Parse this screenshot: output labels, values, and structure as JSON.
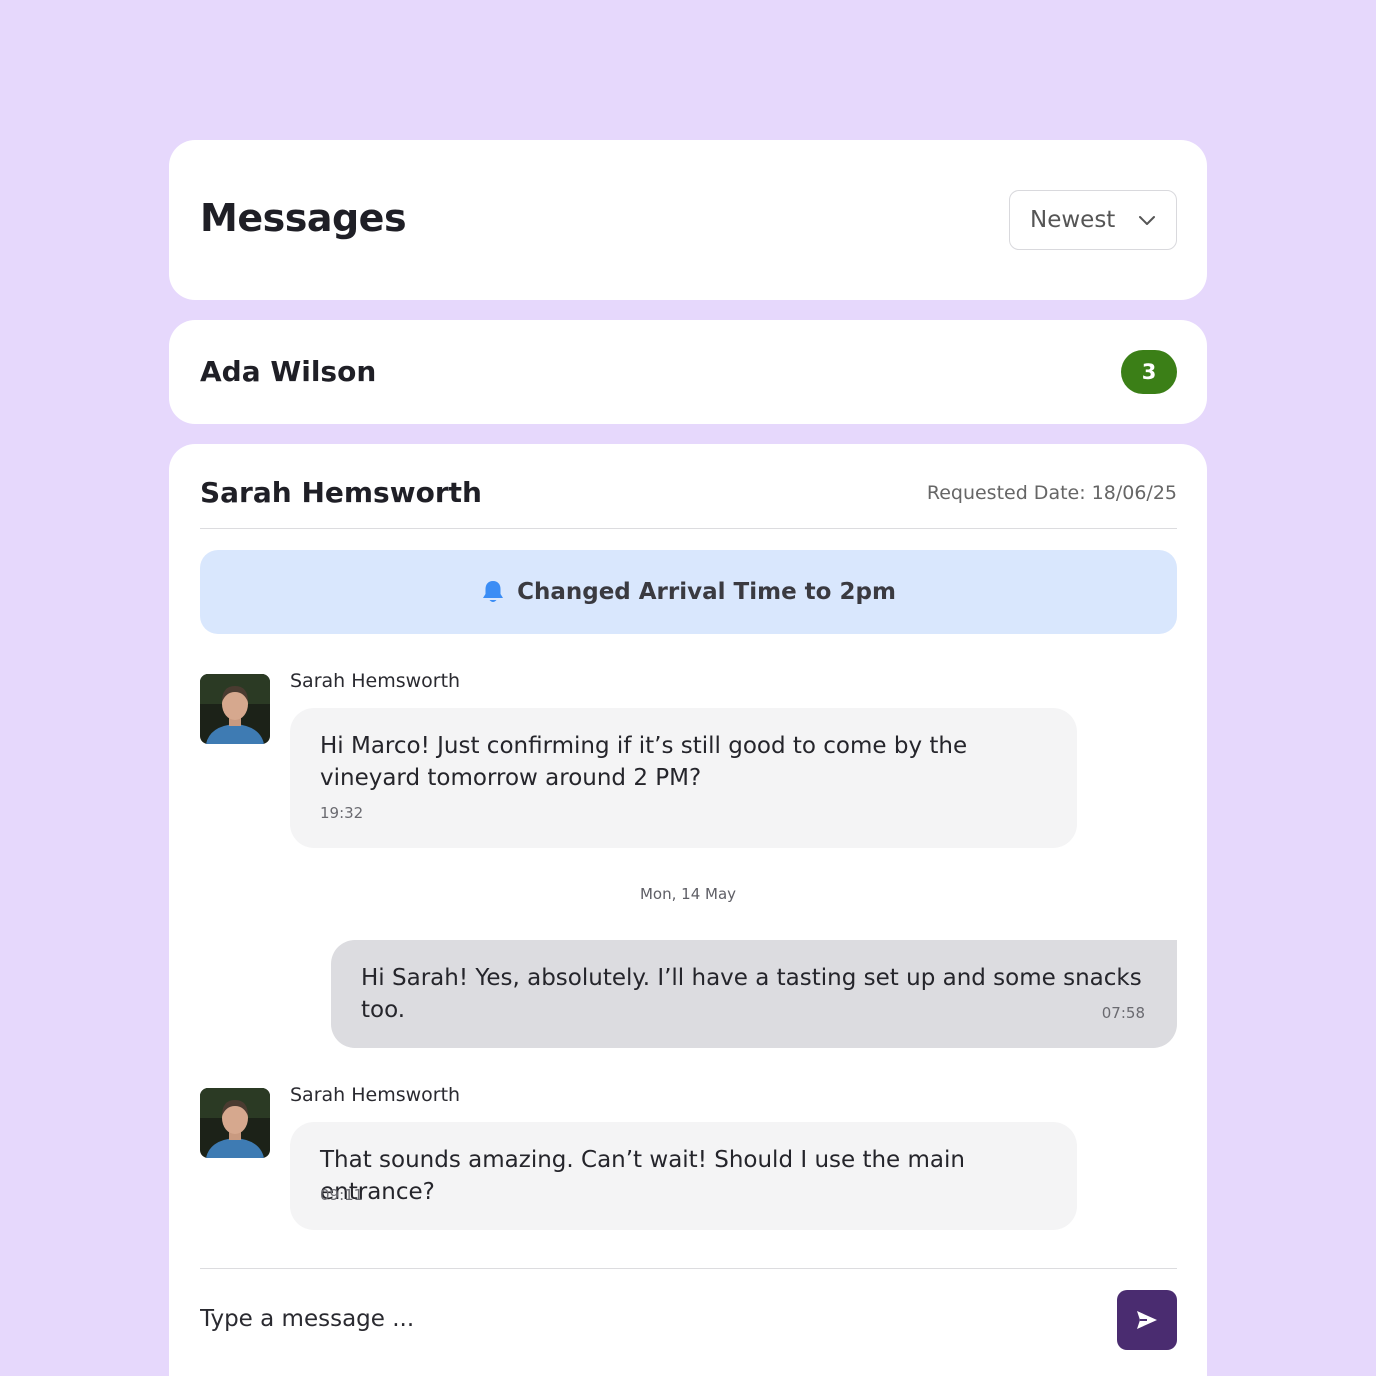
{
  "header": {
    "title": "Messages",
    "sort": {
      "selected": "Newest"
    }
  },
  "contact": {
    "name": "Ada Wilson",
    "unread_count": "3",
    "badge_color": "#3b7f17"
  },
  "conversation": {
    "title": "Sarah Hemsworth",
    "requested_date": "Requested Date: 18/06/25",
    "notice": {
      "icon": "bell-icon",
      "text": "Changed Arrival Time to 2pm"
    },
    "messages": [
      {
        "sender": "Sarah Hemsworth",
        "direction": "incoming",
        "text": "Hi Marco! Just confirming if it’s still good to come by the vineyard tomorrow around 2 PM?",
        "time": "19:32"
      },
      {
        "direction": "outgoing",
        "text": "Hi Sarah! Yes, absolutely. I’ll have a tasting set up and some snacks too.",
        "time": "07:58"
      },
      {
        "sender": "Sarah Hemsworth",
        "direction": "incoming",
        "text": "That sounds amazing. Can’t wait! Should I use the main entrance?",
        "time": "09:11"
      }
    ],
    "date_divider": "Mon, 14 May"
  },
  "composer": {
    "placeholder": "Type a message ...",
    "send_color": "#4a2c70"
  },
  "colors": {
    "background": "#e6d8fc",
    "notice_bg": "#d9e7fd",
    "accent_blue": "#3b8df5"
  }
}
